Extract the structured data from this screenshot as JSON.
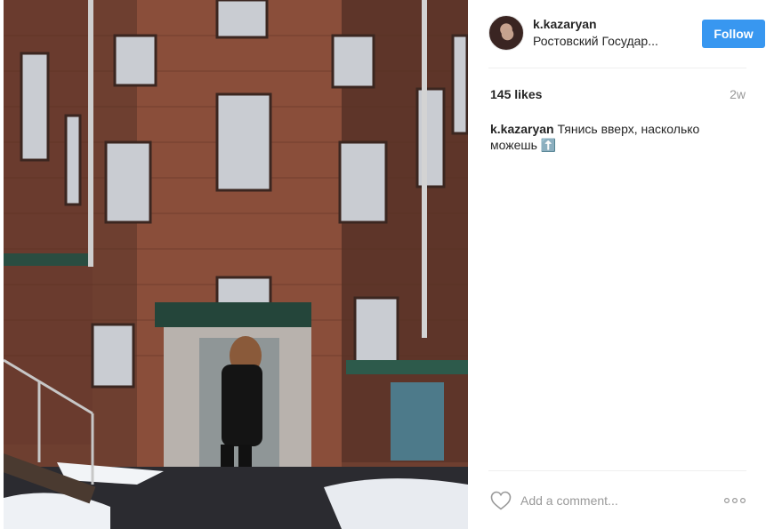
{
  "post": {
    "username": "k.kazaryan",
    "location": "Ростовский Государ...",
    "follow_label": "Follow",
    "likes": "145 likes",
    "time_ago": "2w",
    "caption_user": "k.kazaryan",
    "caption_text": "Тянись вверх, насколько можешь ⬆️",
    "comment_placeholder": "Add a comment..."
  },
  "colors": {
    "follow_button": "#3897f0",
    "text": "#262626",
    "muted": "#999999"
  },
  "icons": {
    "heart": "heart-outline-icon",
    "more": "more-options-icon"
  }
}
